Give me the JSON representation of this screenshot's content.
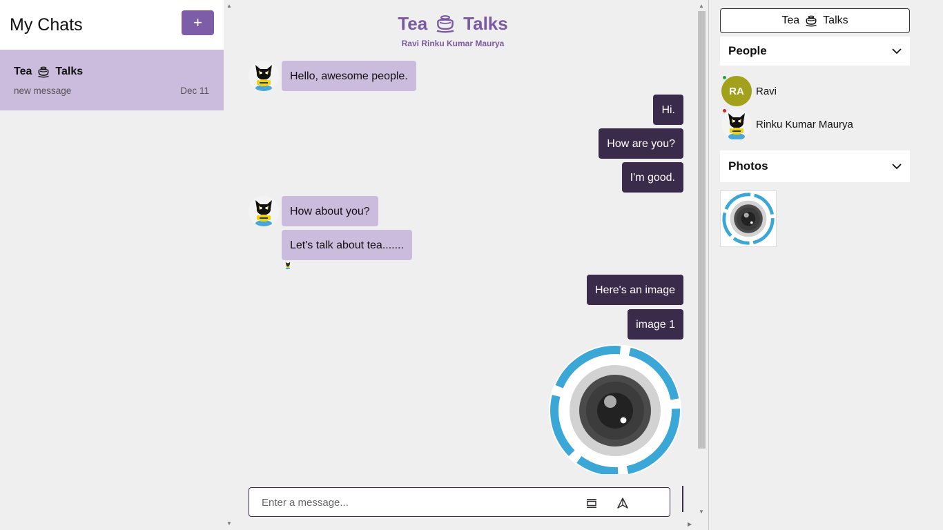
{
  "left": {
    "title": "My Chats",
    "new_chat_label": "+",
    "chats": [
      {
        "name": "Tea",
        "name_suffix": "Talks",
        "preview": "new message",
        "date": "Dec 11"
      }
    ]
  },
  "header": {
    "brand_left": "Tea",
    "brand_right": "Talks",
    "members": "Ravi Rinku Kumar Maurya"
  },
  "messages": [
    {
      "side": "in",
      "text": "Hello, awesome people."
    },
    {
      "side": "out",
      "text": "Hi."
    },
    {
      "side": "out",
      "text": "How are you?"
    },
    {
      "side": "out",
      "text": "I'm good."
    },
    {
      "side": "in",
      "text": "How about you?"
    },
    {
      "side": "in",
      "text": "Let's talk about tea......."
    },
    {
      "side": "out",
      "text": "Here's an image"
    },
    {
      "side": "out",
      "text": "image 1"
    }
  ],
  "composer": {
    "placeholder": "Enter a message...",
    "value": ""
  },
  "right": {
    "group_name_left": "Tea",
    "group_name_right": "Talks",
    "people_label": "People",
    "people": [
      {
        "initials": "RA",
        "name": "Ravi",
        "status_color": "#2ea043"
      },
      {
        "initials": "",
        "name": "Rinku Kumar Maurya",
        "status_color": "#d1242f"
      }
    ],
    "photos_label": "Photos"
  },
  "colors": {
    "accent": "#7d5ca8",
    "incoming_bubble": "#cbbcdd",
    "outgoing_bubble": "#3b2b4b",
    "ravi_avatar": "#a3a11b",
    "camera_ring": "#3aa7d6"
  },
  "icons": {
    "new_chat": "plus-icon",
    "brand": "tea-cup-icon",
    "attach": "attachment-icon",
    "send": "send-icon",
    "collapse": "chevron-down-icon"
  }
}
